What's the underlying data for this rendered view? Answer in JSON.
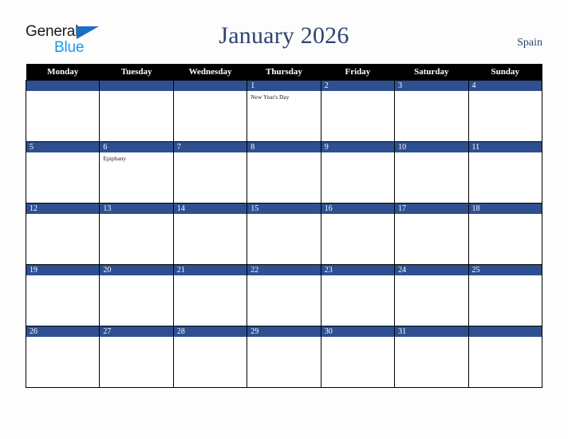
{
  "brand": {
    "name_part1": "General",
    "name_part2": "Blue",
    "triangle_color": "#1a6fc4",
    "part1_color": "#1b1b1b",
    "part2_color": "#2196e8"
  },
  "header": {
    "title": "January 2026",
    "country": "Spain",
    "title_color": "#2d4470"
  },
  "calendar": {
    "weekday_headers": [
      "Monday",
      "Tuesday",
      "Wednesday",
      "Thursday",
      "Friday",
      "Saturday",
      "Sunday"
    ],
    "header_bg": "#000000",
    "header_text_color": "#ffffff",
    "daybar_bg": "#2e5090",
    "daybar_text_color": "#ffffff",
    "cell_bg": "#ffffff",
    "grid_line_color": "#000000",
    "weeks": [
      [
        {
          "date": "",
          "events": []
        },
        {
          "date": "",
          "events": []
        },
        {
          "date": "",
          "events": []
        },
        {
          "date": "1",
          "events": [
            "New Year's Day"
          ]
        },
        {
          "date": "2",
          "events": []
        },
        {
          "date": "3",
          "events": []
        },
        {
          "date": "4",
          "events": []
        }
      ],
      [
        {
          "date": "5",
          "events": []
        },
        {
          "date": "6",
          "events": [
            "Epiphany"
          ]
        },
        {
          "date": "7",
          "events": []
        },
        {
          "date": "8",
          "events": []
        },
        {
          "date": "9",
          "events": []
        },
        {
          "date": "10",
          "events": []
        },
        {
          "date": "11",
          "events": []
        }
      ],
      [
        {
          "date": "12",
          "events": []
        },
        {
          "date": "13",
          "events": []
        },
        {
          "date": "14",
          "events": []
        },
        {
          "date": "15",
          "events": []
        },
        {
          "date": "16",
          "events": []
        },
        {
          "date": "17",
          "events": []
        },
        {
          "date": "18",
          "events": []
        }
      ],
      [
        {
          "date": "19",
          "events": []
        },
        {
          "date": "20",
          "events": []
        },
        {
          "date": "21",
          "events": []
        },
        {
          "date": "22",
          "events": []
        },
        {
          "date": "23",
          "events": []
        },
        {
          "date": "24",
          "events": []
        },
        {
          "date": "25",
          "events": []
        }
      ],
      [
        {
          "date": "26",
          "events": []
        },
        {
          "date": "27",
          "events": []
        },
        {
          "date": "28",
          "events": []
        },
        {
          "date": "29",
          "events": []
        },
        {
          "date": "30",
          "events": []
        },
        {
          "date": "31",
          "events": []
        },
        {
          "date": "",
          "events": []
        }
      ]
    ]
  }
}
